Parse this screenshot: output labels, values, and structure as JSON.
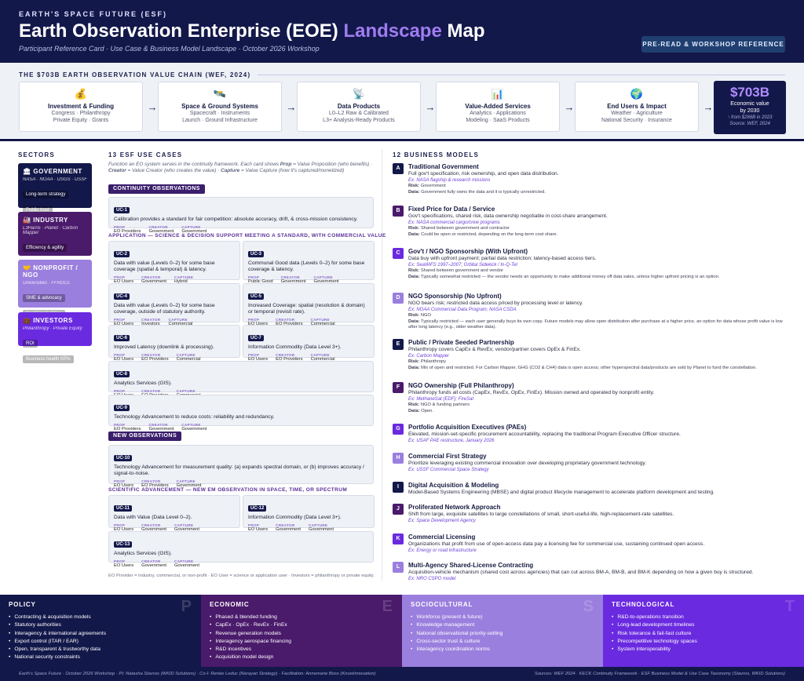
{
  "header": {
    "org": "EARTH'S SPACE FUTURE (ESF)",
    "title_main": "Earth Observation Enterprise (EOE) ",
    "title_highlight": "Landscape",
    "title_end": " Map",
    "subtitle": "Participant Reference Card · Use Case & Business Model Landscape · October 2026 Workshop",
    "badge": "PRE-READ & WORKSHOP REFERENCE"
  },
  "value_chain": {
    "title": "THE $703B EARTH OBSERVATION VALUE CHAIN (WEF, 2024)",
    "stages": [
      {
        "icon": "💰",
        "name": "Investment & Funding",
        "d1": "Congress · Philanthropy",
        "d2": "Private Equity · Grants"
      },
      {
        "icon": "🛰️",
        "name": "Space & Ground Systems",
        "d1": "Spacecraft · Instruments",
        "d2": "Launch · Ground Infrastructure"
      },
      {
        "icon": "📡",
        "name": "Data Products",
        "d1": "L0–L2 Raw & Calibrated",
        "d2": "L3+ Analysis-Ready Products"
      },
      {
        "icon": "📊",
        "name": "Value-Added Services",
        "d1": "Analytics · Applications",
        "d2": "Modeling · SaaS Products"
      },
      {
        "icon": "🌍",
        "name": "End Users & Impact",
        "d1": "Weather · Agriculture",
        "d2": "National Security · Insurance"
      }
    ],
    "arrow": "→",
    "total": {
      "value": "$703B",
      "l1": "Economic value",
      "l2": "by 2030",
      "l3": "↑ from $266B in 2023",
      "l4": "Source: WEF, 2024"
    }
  },
  "sectors": {
    "title": "SECTORS",
    "items": [
      {
        "name": "GOVERNMENT",
        "icon": "🏛",
        "sub": "NASA · NOAA · USGS · USSF",
        "tags": [
          "Long-term strategy",
          "Public trust"
        ],
        "color": "#13184a"
      },
      {
        "name": "INDUSTRY",
        "icon": "🏭",
        "sub": "L3Harris · Planet · Carbon Mapper",
        "tags": [
          "Efficiency & agility",
          "Cost accountability"
        ],
        "color": "#4a1a6b"
      },
      {
        "name": "NONPROFIT / NGO",
        "icon": "🤝",
        "sub": "Universities · FFRDCs",
        "tags": [
          "SME & advocacy",
          "Coalition building"
        ],
        "color": "#9b7fde"
      },
      {
        "name": "INVESTORS",
        "icon": "💼",
        "sub": "Philanthropy · Private Equity",
        "tags": [
          "ROI",
          "Business health KPIs"
        ],
        "color": "#6a2ae0"
      }
    ]
  },
  "use_cases": {
    "title": "13 ESF USE CASES",
    "intro1": "Function an EO system serves in the continuity framework. Each card shows ",
    "intro_prop": "Prop",
    "intro2": " = Value Proposition (who benefits) · ",
    "intro_creator": "Creator",
    "intro3": " = Value Creator (who creates the value) · ",
    "intro_capture": "Capture",
    "intro4": " = Value Capture (how it's captured/monetized)",
    "band_continuity": "CONTINUITY OBSERVATIONS",
    "sub_application": "APPLICATION — SCIENCE & DECISION SUPPORT MEETING A STANDARD, WITH COMMERCIAL VALUE",
    "band_new": "NEW OBSERVATIONS",
    "sub_scientific": "SCIENTIFIC ADVANCEMENT — NEW EM OBSERVATION IN SPACE, TIME, OR SPECTRUM",
    "labels": {
      "prop": "PROP",
      "creator": "CREATOR",
      "capture": "CAPTURE"
    },
    "cards": [
      {
        "id": "UC-1",
        "desc": "Calibration provides a standard for fair competition: absolute accuracy, drift, & cross-mission consistency.",
        "prop": "EO Providers",
        "creator": "Government",
        "capture": "Government"
      },
      {
        "id": "UC-2",
        "desc": "Data with value (Levels 0–2) for some base coverage (spatial & temporal) & latency.",
        "prop": "EO Users",
        "creator": "Government",
        "capture": "Hybrid"
      },
      {
        "id": "UC-3",
        "desc": "Communal Good data (Levels 0–2) for some base coverage & latency.",
        "prop": "Public Good",
        "creator": "Government",
        "capture": "Government"
      },
      {
        "id": "UC-4",
        "desc": "Data with value (Levels 0–2) for some base coverage, outside of statutory authority.",
        "prop": "EO Users",
        "creator": "Investors",
        "capture": "Commercial"
      },
      {
        "id": "UC-5",
        "desc": "Increased Coverage: spatial (resolution & domain) or temporal (revisit rate).",
        "prop": "EO Users",
        "creator": "EO Providers",
        "capture": "Commercial"
      },
      {
        "id": "UC-6",
        "desc": "Improved Latency (downlink & processing).",
        "prop": "EO Users",
        "creator": "EO Providers",
        "capture": "Commercial"
      },
      {
        "id": "UC-7",
        "desc": "Information Commodity (Data Level 3+).",
        "prop": "EO Users",
        "creator": "EO Providers",
        "capture": "Commercial"
      },
      {
        "id": "UC-8",
        "desc": "Analytics Services (GIS).",
        "prop": "EO Users",
        "creator": "EO Providers",
        "capture": "Commercial"
      },
      {
        "id": "UC-9",
        "desc": "Technology Advancement to reduce costs: reliability and redundancy.",
        "prop": "EO Providers",
        "creator": "Government",
        "capture": "Government"
      },
      {
        "id": "UC-10",
        "desc": "Technology Advancement for measurement quality: (a) expands spectral domain, or (b) improves accuracy / signal-to-noise.",
        "prop": "EO Users",
        "creator": "EO Providers",
        "capture": "Government"
      },
      {
        "id": "UC-11",
        "desc": "Data with Value (Data Level 0–2).",
        "prop": "EO Users",
        "creator": "Government",
        "capture": "Government"
      },
      {
        "id": "UC-12",
        "desc": "Information Commodity (Data Level 3+).",
        "prop": "EO Users",
        "creator": "Government",
        "capture": "Government"
      },
      {
        "id": "UC-13",
        "desc": "Analytics Services (GIS).",
        "prop": "EO Users",
        "creator": "Government",
        "capture": "Government"
      }
    ],
    "legend": "EO Provider = industry, commercial, or non-profit · EO User = science or application user · Investors = philanthropy or private equity."
  },
  "business_models": {
    "title": "12 BUSINESS MODELS",
    "items": [
      {
        "letter": "A",
        "title": "Traditional Government",
        "desc": "Full gov't specification, risk ownership, and open data distribution.",
        "ex": "Ex: NASA flagship & research missions",
        "risk": "Government",
        "data": "Government fully owns the data and it is typically unrestricted.",
        "color": "#13184a"
      },
      {
        "letter": "B",
        "title": "Fixed Price for Data / Service",
        "desc": "Gov't specifications, shared risk, data ownership negotiable in cost-share arrangement.",
        "ex": "Ex: NASA commercial cargo/crew programs",
        "risk": "Shared between government and contractor",
        "data": "Could be open or restricted, depending on the long-term cost share.",
        "color": "#4a1a6b"
      },
      {
        "letter": "C",
        "title": "Gov't / NGO Sponsorship (With Upfront)",
        "desc": "Data buy with upfront payment; partial data restriction; latency-based access tiers.",
        "ex": "Ex: SeaWiFS 1997–2007; Orbital Sidekick / In-Q-Tel",
        "risk": "Shared between government and vendor",
        "data": "Typically somewhat restricted — the vendor needs an opportunity to make additional money off data sales, unless higher upfront pricing is an option.",
        "color": "#6a2ae0"
      },
      {
        "letter": "D",
        "title": "NGO Sponsorship (No Upfront)",
        "desc": "NGO bears risk; restricted data access priced by processing level or latency.",
        "ex": "Ex: NOAA Commercial Data Program; NASA CSDA",
        "risk": "NGO",
        "data": "Typically restricted — each user generally buys its own copy. Future models may allow open distribution after purchase at a higher price, an option for data whose profit value is low after long latency (e.g., older weather data).",
        "color": "#9b7fde"
      },
      {
        "letter": "E",
        "title": "Public / Private Seeded Partnership",
        "desc": "Philanthropy covers CapEx & RevEx; vendor/partner covers OpEx & FinEx.",
        "ex": "Ex: Carbon Mapper",
        "risk": "Philanthropy",
        "data": "Mix of open and restricted. For Carbon Mapper, GHG (CO2 & CH4) data is open access; other hyperspectral data/products are sold by Planet to fund the constellation.",
        "color": "#13184a"
      },
      {
        "letter": "F",
        "title": "NGO Ownership (Full Philanthropy)",
        "desc": "Philanthropy funds all costs (CapEx, RevEx, OpEx, FinEx). Mission owned and operated by nonprofit entity.",
        "ex": "Ex: MethaneSat (EDF); FireSat",
        "risk": "NGO & funding partners",
        "data": "Open.",
        "color": "#4a1a6b"
      },
      {
        "letter": "G",
        "title": "Portfolio Acquisition Executives (PAEs)",
        "desc": "Elevated, mission-set-specific procurement accountability, replacing the traditional Program Executive Officer structure.",
        "ex": "Ex: USAF PAE restructure, January 2026",
        "color": "#6a2ae0"
      },
      {
        "letter": "H",
        "title": "Commercial First Strategy",
        "desc": "Prioritize leveraging existing commercial innovation over developing proprietary government technology.",
        "ex": "Ex: USSF Commercial Space Strategy",
        "color": "#9b7fde"
      },
      {
        "letter": "I",
        "title": "Digital Acquisition & Modeling",
        "desc": "Model-Based Systems Engineering (MBSE) and digital product lifecycle management to accelerate platform development and testing.",
        "color": "#13184a"
      },
      {
        "letter": "J",
        "title": "Proliferated Network Approach",
        "desc": "Shift from large, exquisite satellites to large constellations of small, short-useful-life, high-replacement-rate satellites.",
        "ex": "Ex: Space Development Agency",
        "color": "#4a1a6b"
      },
      {
        "letter": "K",
        "title": "Commercial Licensing",
        "desc": "Organizations that profit from use of open-access data pay a licensing fee for commercial use, sustaining continued open access.",
        "ex": "Ex: Energy or road infrastructure",
        "color": "#6a2ae0"
      },
      {
        "letter": "L",
        "title": "Multi-Agency Shared-License Contracting",
        "desc": "Acquisition-vehicle mechanism (shared cost across agencies) that can cut across BM-A, BM-B, and BM-K depending on how a given buy is structured.",
        "ex": "Ex: NRO CSPO model",
        "color": "#9b7fde"
      }
    ],
    "risk_label": "Risk:",
    "data_label": "Data:"
  },
  "pest": [
    {
      "title": "POLICY",
      "letter": "P",
      "color": "#13184a",
      "items": [
        "Contracting & acquisition models",
        "Statutory authorities",
        "Interagency & international agreements",
        "Export control (ITAR / EAR)",
        "Open, transparent & trustworthy data",
        "National security constraints"
      ]
    },
    {
      "title": "ECONOMIC",
      "letter": "E",
      "color": "#4a1a6b",
      "items": [
        "Phased & blended funding",
        "CapEx · OpEx · RevEx · FinEx",
        "Revenue generation models",
        "Interagency aerospace financing",
        "R&D incentives",
        "Acquisition model design"
      ]
    },
    {
      "title": "SOCIOCULTURAL",
      "letter": "S",
      "color": "#9b7fde",
      "items": [
        "Workforce (present & future)",
        "Knowledge management",
        "National observational priority-setting",
        "Cross-sector trust & culture",
        "Interagency coordination norms"
      ]
    },
    {
      "title": "TECHNOLOGICAL",
      "letter": "T",
      "color": "#6a2ae0",
      "items": [
        "R&D-to-operations transition",
        "Long-lead development timelines",
        "Risk tolerance & fail-fast culture",
        "Precompetitive technology spaces",
        "System interoperability"
      ]
    }
  ],
  "footer": {
    "left": "Earth's Space Future · October 2026 Workshop · PI: Natasha Stavros (WKID Solutions) · Co-I: Renée Leduc (Narayan Strategy) · Facilitation: Annemarie Boss (KnowInnovation)",
    "right": "Sources: WEF 2024 · KECK Continuity Framework · ESF Business Model & Use Case Taxonomy (Stavros, WKID Solutions)"
  }
}
